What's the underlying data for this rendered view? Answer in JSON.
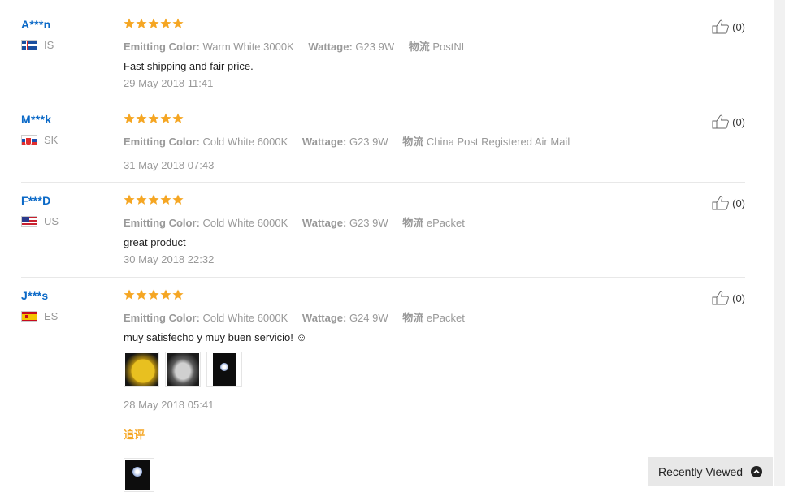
{
  "reviews": [
    {
      "user": "A***n",
      "country": "IS",
      "attrs": [
        {
          "key": "Emitting Color:",
          "value": "Warm White 3000K"
        },
        {
          "key": "Wattage:",
          "value": "G23 9W"
        },
        {
          "key": "物流",
          "value": "PostNL"
        }
      ],
      "feedback": "Fast shipping and fair price.",
      "date": "29 May 2018 11:41",
      "likes": "(0)"
    },
    {
      "user": "M***k",
      "country": "SK",
      "attrs": [
        {
          "key": "Emitting Color:",
          "value": "Cold White 6000K"
        },
        {
          "key": "Wattage:",
          "value": "G23 9W"
        },
        {
          "key": "物流",
          "value": "China Post Registered Air Mail"
        }
      ],
      "feedback": "",
      "date": "31 May 2018 07:43",
      "likes": "(0)"
    },
    {
      "user": "F***D",
      "country": "US",
      "attrs": [
        {
          "key": "Emitting Color:",
          "value": "Cold White 6000K"
        },
        {
          "key": "Wattage:",
          "value": "G23 9W"
        },
        {
          "key": "物流",
          "value": "ePacket"
        }
      ],
      "feedback": "great product",
      "date": "30 May 2018 22:32",
      "likes": "(0)"
    },
    {
      "user": "J***s",
      "country": "ES",
      "attrs": [
        {
          "key": "Emitting Color:",
          "value": "Cold White 6000K"
        },
        {
          "key": "Wattage:",
          "value": "G24 9W"
        },
        {
          "key": "物流",
          "value": "ePacket"
        }
      ],
      "feedback": "muy satisfecho y muy buen servicio! ☺",
      "date": "28 May 2018 05:41",
      "likes": "(0)",
      "followup_label": "追评"
    }
  ],
  "rating": {
    "stars": 5,
    "max": 5
  },
  "colors": {
    "star": "#f5a623",
    "username": "#0b69c7",
    "muted": "#999999"
  },
  "recently_viewed": {
    "label": "Recently Viewed"
  }
}
